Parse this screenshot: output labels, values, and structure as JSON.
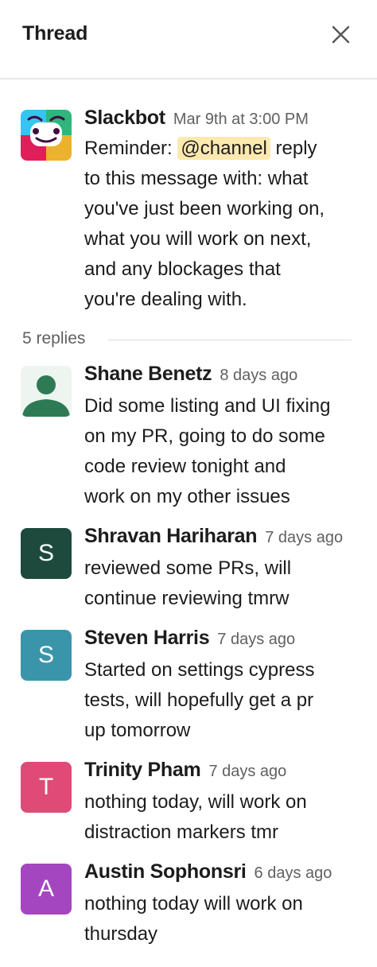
{
  "header": {
    "title": "Thread"
  },
  "parent": {
    "author": "Slackbot",
    "timestamp": "Mar 9th at 3:00 PM",
    "text_prefix": "Reminder:",
    "mention": "@channel",
    "text_line1_suffix": "reply",
    "text_lines": [
      "to this message with: what",
      "you've just been working on,",
      "what you will work on next,",
      "and any blockages that",
      "you're dealing with."
    ]
  },
  "replies_label": "5 replies",
  "replies": [
    {
      "author": "Shane Benetz",
      "timestamp": "8 days ago",
      "avatar_letter": "",
      "avatar_color": "#e8f5e9",
      "lines": [
        "Did some listing and UI fixing",
        "on my PR, going to do some",
        "code review tonight and",
        "work on my other issues"
      ]
    },
    {
      "author": "Shravan Hariharan",
      "timestamp": "7 days ago",
      "avatar_letter": "S",
      "avatar_color": "#1e4a3e",
      "lines": [
        "reviewed some PRs, will",
        "continue reviewing tmrw"
      ]
    },
    {
      "author": "Steven Harris",
      "timestamp": "7 days ago",
      "avatar_letter": "S",
      "avatar_color": "#3a95ab",
      "lines": [
        "Started on settings cypress",
        "tests, will hopefully get a pr",
        "up tomorrow"
      ]
    },
    {
      "author": "Trinity Pham",
      "timestamp": "7 days ago",
      "avatar_letter": "T",
      "avatar_color": "#df4a76",
      "lines": [
        "nothing today, will work on",
        "distraction markers tmr"
      ]
    },
    {
      "author": "Austin Sophonsri",
      "timestamp": "6 days ago",
      "avatar_letter": "A",
      "avatar_color": "#a346c0",
      "lines": [
        "nothing today will work on",
        "thursday"
      ]
    }
  ],
  "icons": {
    "close": "close-icon",
    "slackbot_avatar": "slackbot-avatar-icon",
    "default_avatar": "person-icon"
  }
}
